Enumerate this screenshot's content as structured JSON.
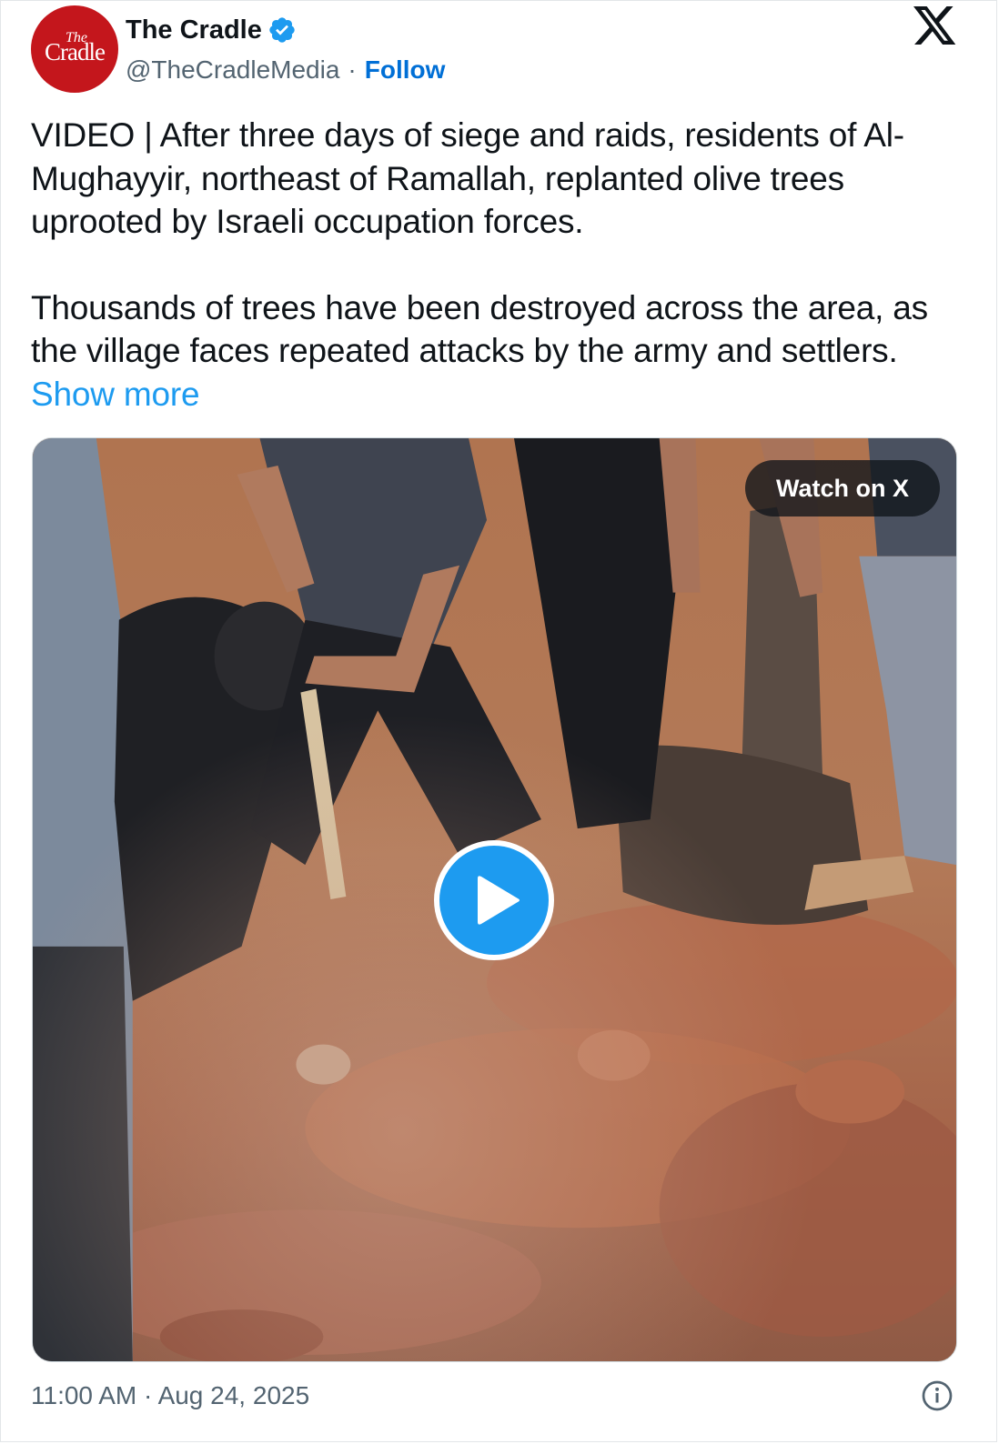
{
  "author": {
    "display_name": "The Cradle",
    "handle": "@TheCradleMedia",
    "separator": "·",
    "follow_label": "Follow",
    "avatar_logo_top": "The",
    "avatar_logo_bottom": "Cradle",
    "avatar_color": "#c4161c",
    "verified_color": "#1d9bf0"
  },
  "tweet": {
    "paragraph_1": "VIDEO | After three days of siege and raids, residents of Al-Mughayyir, northeast of Ramallah, replanted olive trees uprooted by Israeli occupation forces.",
    "paragraph_2_prefix": "Thousands of trees have been destroyed across the area, as the village faces repeated attacks by the army and settlers. ",
    "show_more_label": "Show more"
  },
  "media": {
    "type": "video",
    "watch_label": "Watch on X",
    "play_icon": "play-icon",
    "accent_color": "#1d9bf0"
  },
  "footer": {
    "timestamp": "11:00 AM · Aug 24, 2025",
    "info_icon": "info-icon"
  },
  "icons": {
    "brand": "x-logo-icon",
    "verified": "verified-badge-icon"
  },
  "colors": {
    "link": "#006fd6",
    "show_more": "#1d9bf0",
    "secondary_text": "#536471"
  }
}
